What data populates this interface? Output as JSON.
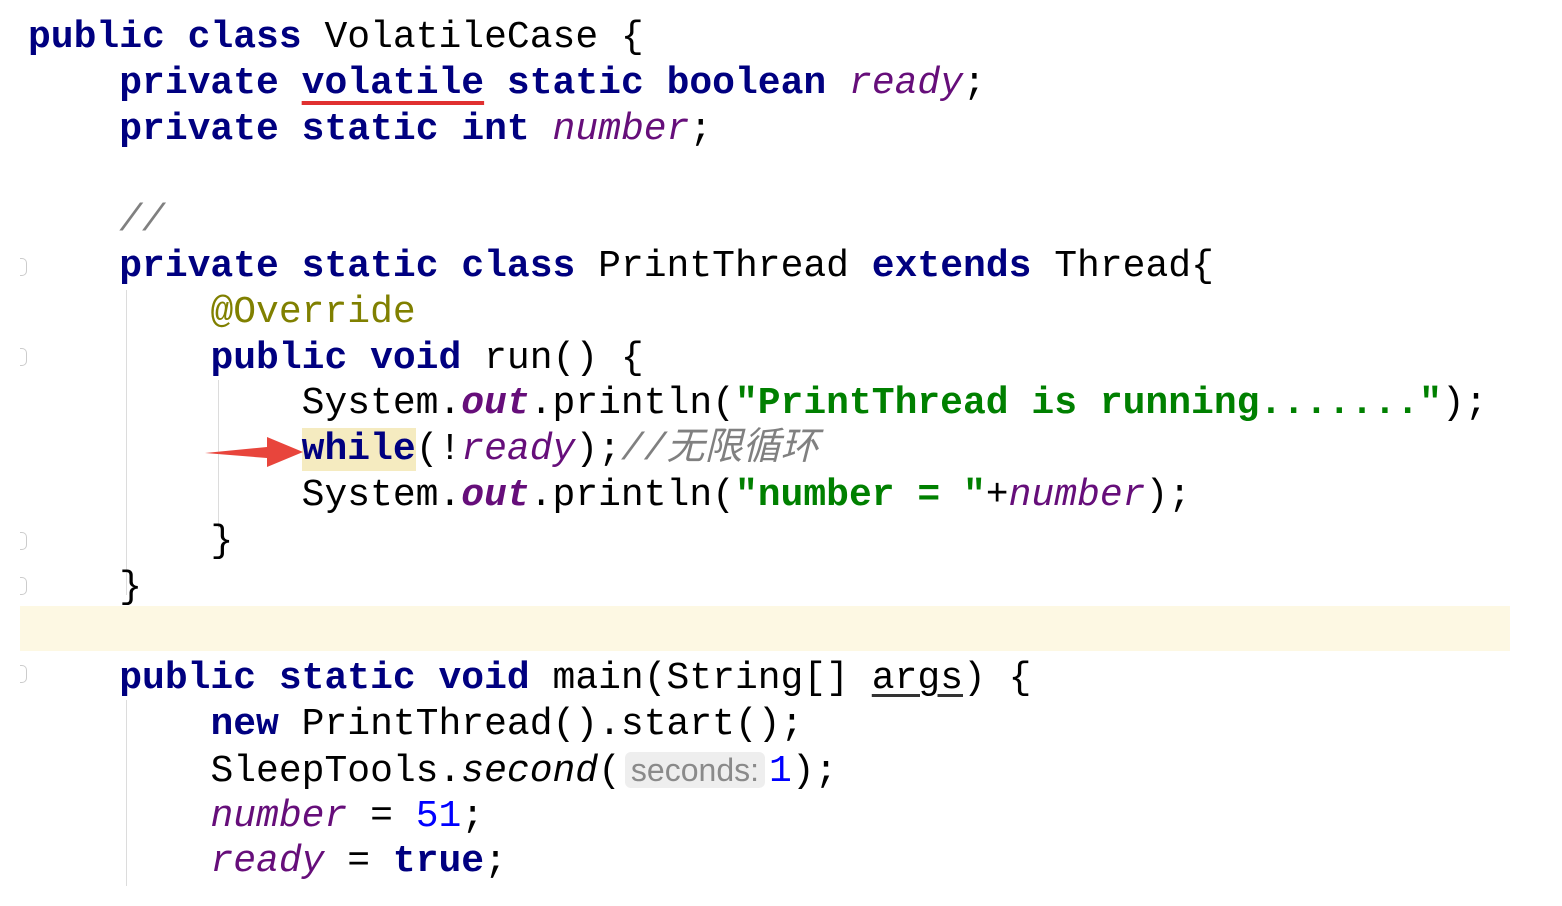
{
  "editor": {
    "language": "java",
    "current_line_color": "#FDF8E3",
    "arrow_color": "#E8453C",
    "lines": [
      {
        "indent": 0,
        "tokens": [
          [
            "public",
            "kw"
          ],
          [
            " ",
            ""
          ],
          [
            "class",
            "kw"
          ],
          [
            " VolatileCase {",
            ""
          ]
        ]
      },
      {
        "indent": 1,
        "tokens": [
          [
            "private",
            "kw"
          ],
          [
            " ",
            ""
          ],
          [
            "volatile",
            "kw err"
          ],
          [
            " ",
            ""
          ],
          [
            "static",
            "kw"
          ],
          [
            " ",
            ""
          ],
          [
            "boolean",
            "kw"
          ],
          [
            " ",
            ""
          ],
          [
            "ready",
            "field"
          ],
          [
            ";",
            ""
          ]
        ]
      },
      {
        "indent": 1,
        "tokens": [
          [
            "private",
            "kw"
          ],
          [
            " ",
            ""
          ],
          [
            "static",
            "kw"
          ],
          [
            " ",
            ""
          ],
          [
            "int",
            "kw"
          ],
          [
            " ",
            ""
          ],
          [
            "number",
            "field"
          ],
          [
            ";",
            ""
          ]
        ]
      },
      {
        "indent": 0,
        "tokens": []
      },
      {
        "indent": 1,
        "tokens": [
          [
            "//",
            "comment"
          ]
        ]
      },
      {
        "indent": 1,
        "tokens": [
          [
            "private",
            "kw"
          ],
          [
            " ",
            ""
          ],
          [
            "static",
            "kw"
          ],
          [
            " ",
            ""
          ],
          [
            "class",
            "kw"
          ],
          [
            " PrintThread ",
            ""
          ],
          [
            "extends",
            "kw"
          ],
          [
            " Thread{",
            ""
          ]
        ]
      },
      {
        "indent": 2,
        "tokens": [
          [
            "@Override",
            "anno"
          ]
        ]
      },
      {
        "indent": 2,
        "tokens": [
          [
            "public",
            "kw"
          ],
          [
            " ",
            ""
          ],
          [
            "void",
            "kw"
          ],
          [
            " run() {",
            ""
          ]
        ]
      },
      {
        "indent": 3,
        "tokens": [
          [
            "System.",
            ""
          ],
          [
            "out",
            "static-field"
          ],
          [
            ".println(",
            ""
          ],
          [
            "\"PrintThread is running.......\"",
            "str"
          ],
          [
            ");",
            ""
          ]
        ]
      },
      {
        "indent": 3,
        "tokens": [
          [
            "while",
            "kw match"
          ],
          [
            "(!",
            ""
          ],
          [
            "ready",
            "field"
          ],
          [
            ");",
            ""
          ],
          [
            "//无限循环",
            "comment"
          ]
        ]
      },
      {
        "indent": 3,
        "tokens": [
          [
            "System.",
            ""
          ],
          [
            "out",
            "static-field"
          ],
          [
            ".println(",
            ""
          ],
          [
            "\"number = \"",
            "str"
          ],
          [
            "+",
            ""
          ],
          [
            "number",
            "field"
          ],
          [
            ");",
            ""
          ]
        ]
      },
      {
        "indent": 2,
        "tokens": [
          [
            "}",
            ""
          ]
        ]
      },
      {
        "indent": 1,
        "tokens": [
          [
            "}",
            ""
          ]
        ]
      },
      {
        "indent": 0,
        "tokens": []
      },
      {
        "indent": 1,
        "tokens": [
          [
            "public",
            "kw"
          ],
          [
            " ",
            ""
          ],
          [
            "static",
            "kw"
          ],
          [
            " ",
            ""
          ],
          [
            "void",
            "kw"
          ],
          [
            " main(String[] ",
            ""
          ],
          [
            "args",
            "underline-var"
          ],
          [
            ") {",
            ""
          ]
        ]
      },
      {
        "indent": 2,
        "tokens": [
          [
            "new",
            "kw"
          ],
          [
            " PrintThread().start();",
            ""
          ]
        ]
      },
      {
        "indent": 2,
        "tokens": [
          [
            "SleepTools.",
            ""
          ],
          [
            "second",
            "method-static"
          ],
          [
            "(",
            ""
          ],
          [
            "seconds:",
            "hint"
          ],
          [
            "1",
            "num"
          ],
          [
            ");",
            ""
          ]
        ]
      },
      {
        "indent": 2,
        "tokens": [
          [
            "number",
            "field"
          ],
          [
            " = ",
            ""
          ],
          [
            "51",
            "num"
          ],
          [
            ";",
            ""
          ]
        ]
      },
      {
        "indent": 2,
        "tokens": [
          [
            "ready",
            "field"
          ],
          [
            " = ",
            ""
          ],
          [
            "true",
            "kw"
          ],
          [
            ";",
            ""
          ]
        ]
      }
    ]
  }
}
